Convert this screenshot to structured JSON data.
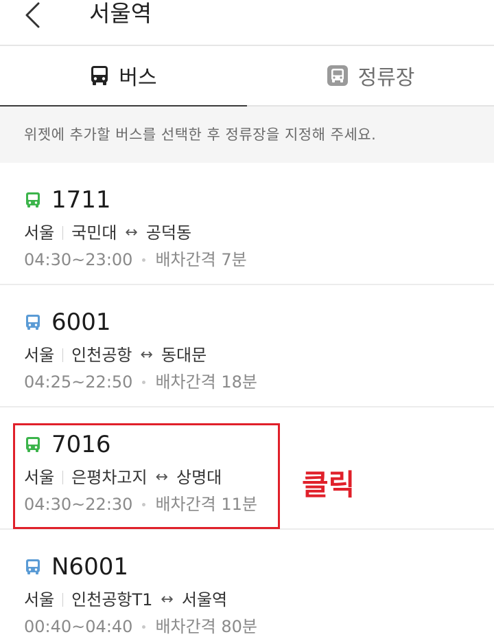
{
  "header": {
    "title": "서울역"
  },
  "tabs": [
    {
      "label": "버스",
      "active": true
    },
    {
      "label": "정류장",
      "active": false
    }
  ],
  "notice": "위젯에 추가할 버스를 선택한 후 정류장을 지정해 주세요.",
  "routes": [
    {
      "number": "1711",
      "region": "서울",
      "from": "국민대",
      "to": "공덕동",
      "hours": "04:30~23:00",
      "interval": "배차간격 7분",
      "color": "#3cb44b"
    },
    {
      "number": "6001",
      "region": "서울",
      "from": "인천공항",
      "to": "동대문",
      "hours": "04:25~22:50",
      "interval": "배차간격 18분",
      "color": "#5a9bd5"
    },
    {
      "number": "7016",
      "region": "서울",
      "from": "은평차고지",
      "to": "상명대",
      "hours": "04:30~22:30",
      "interval": "배차간격 11분",
      "color": "#3cb44b"
    },
    {
      "number": "N6001",
      "region": "서울",
      "from": "인천공항T1",
      "to": "서울역",
      "hours": "00:40~04:40",
      "interval": "배차간격 80분",
      "color": "#5a9bd5"
    }
  ],
  "annotation": {
    "label": "클릭",
    "color": "#e0202a"
  }
}
